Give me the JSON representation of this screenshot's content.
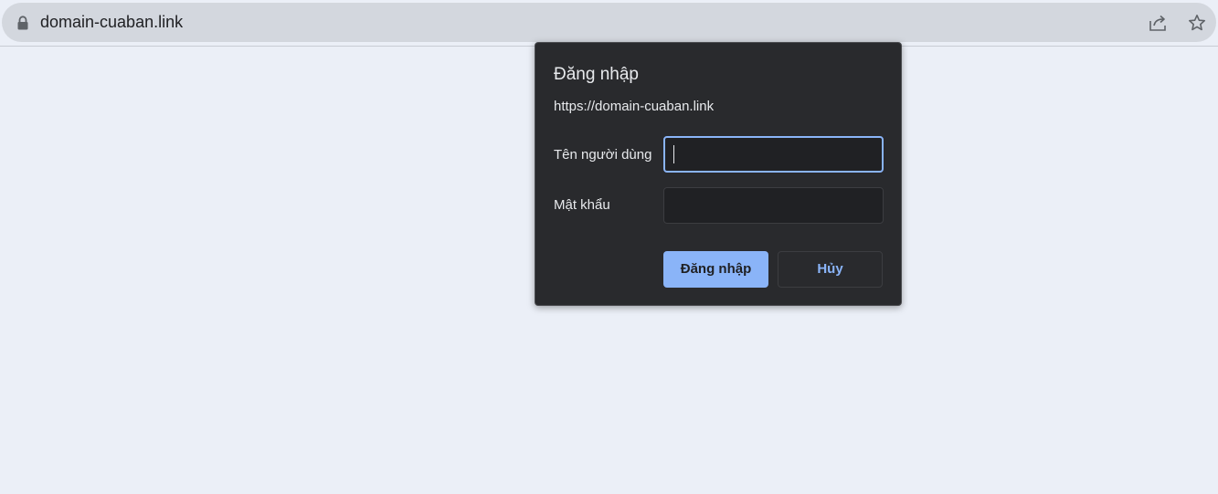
{
  "browser": {
    "url": "domain-cuaban.link",
    "icons": [
      "lock-icon",
      "share-icon",
      "bookmark-star-icon"
    ]
  },
  "dialog": {
    "title": "Đăng nhập",
    "origin": "https://domain-cuaban.link",
    "username_label": "Tên người dùng",
    "username_value": "",
    "password_label": "Mật khẩu",
    "password_value": "",
    "submit_label": "Đăng nhập",
    "cancel_label": "Hủy"
  },
  "colors": {
    "accent": "#8ab4f8",
    "dialog_bg": "#292a2d",
    "page_bg": "#ebeff7"
  }
}
